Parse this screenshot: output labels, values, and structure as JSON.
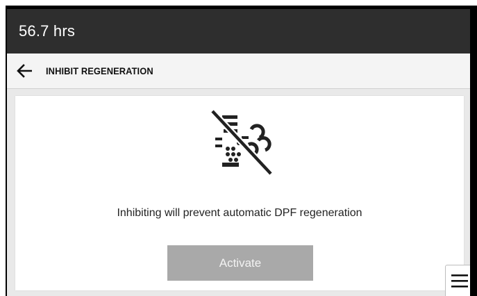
{
  "header": {
    "hours_label": "56.7 hrs"
  },
  "titlebar": {
    "title": "INHIBIT REGENERATION",
    "back_icon": "arrow-left-icon"
  },
  "card": {
    "icon": "dpf-regeneration-inhibited-icon",
    "message": "Inhibiting will prevent automatic DPF regeneration",
    "button_label": "Activate"
  },
  "menu": {
    "icon": "hamburger-menu-icon"
  },
  "colors": {
    "header_bg": "#2e2e2e",
    "button_disabled": "#a9a9a9",
    "background": "#e9e9e9"
  }
}
